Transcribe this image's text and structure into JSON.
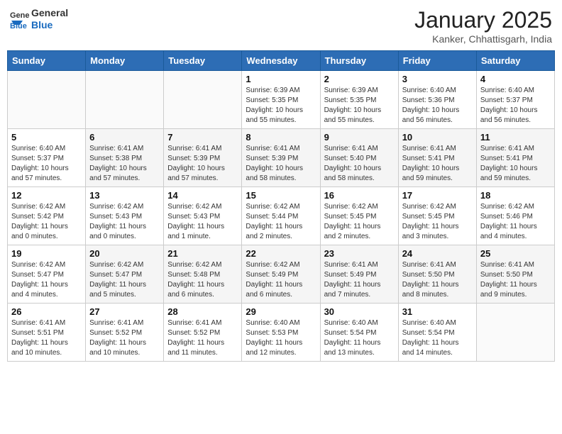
{
  "header": {
    "logo_general": "General",
    "logo_blue": "Blue",
    "month_title": "January 2025",
    "location": "Kanker, Chhattisgarh, India"
  },
  "days_of_week": [
    "Sunday",
    "Monday",
    "Tuesday",
    "Wednesday",
    "Thursday",
    "Friday",
    "Saturday"
  ],
  "weeks": [
    [
      {
        "day": "",
        "info": ""
      },
      {
        "day": "",
        "info": ""
      },
      {
        "day": "",
        "info": ""
      },
      {
        "day": "1",
        "info": "Sunrise: 6:39 AM\nSunset: 5:35 PM\nDaylight: 10 hours\nand 55 minutes."
      },
      {
        "day": "2",
        "info": "Sunrise: 6:39 AM\nSunset: 5:35 PM\nDaylight: 10 hours\nand 55 minutes."
      },
      {
        "day": "3",
        "info": "Sunrise: 6:40 AM\nSunset: 5:36 PM\nDaylight: 10 hours\nand 56 minutes."
      },
      {
        "day": "4",
        "info": "Sunrise: 6:40 AM\nSunset: 5:37 PM\nDaylight: 10 hours\nand 56 minutes."
      }
    ],
    [
      {
        "day": "5",
        "info": "Sunrise: 6:40 AM\nSunset: 5:37 PM\nDaylight: 10 hours\nand 57 minutes."
      },
      {
        "day": "6",
        "info": "Sunrise: 6:41 AM\nSunset: 5:38 PM\nDaylight: 10 hours\nand 57 minutes."
      },
      {
        "day": "7",
        "info": "Sunrise: 6:41 AM\nSunset: 5:39 PM\nDaylight: 10 hours\nand 57 minutes."
      },
      {
        "day": "8",
        "info": "Sunrise: 6:41 AM\nSunset: 5:39 PM\nDaylight: 10 hours\nand 58 minutes."
      },
      {
        "day": "9",
        "info": "Sunrise: 6:41 AM\nSunset: 5:40 PM\nDaylight: 10 hours\nand 58 minutes."
      },
      {
        "day": "10",
        "info": "Sunrise: 6:41 AM\nSunset: 5:41 PM\nDaylight: 10 hours\nand 59 minutes."
      },
      {
        "day": "11",
        "info": "Sunrise: 6:41 AM\nSunset: 5:41 PM\nDaylight: 10 hours\nand 59 minutes."
      }
    ],
    [
      {
        "day": "12",
        "info": "Sunrise: 6:42 AM\nSunset: 5:42 PM\nDaylight: 11 hours\nand 0 minutes."
      },
      {
        "day": "13",
        "info": "Sunrise: 6:42 AM\nSunset: 5:43 PM\nDaylight: 11 hours\nand 0 minutes."
      },
      {
        "day": "14",
        "info": "Sunrise: 6:42 AM\nSunset: 5:43 PM\nDaylight: 11 hours\nand 1 minute."
      },
      {
        "day": "15",
        "info": "Sunrise: 6:42 AM\nSunset: 5:44 PM\nDaylight: 11 hours\nand 2 minutes."
      },
      {
        "day": "16",
        "info": "Sunrise: 6:42 AM\nSunset: 5:45 PM\nDaylight: 11 hours\nand 2 minutes."
      },
      {
        "day": "17",
        "info": "Sunrise: 6:42 AM\nSunset: 5:45 PM\nDaylight: 11 hours\nand 3 minutes."
      },
      {
        "day": "18",
        "info": "Sunrise: 6:42 AM\nSunset: 5:46 PM\nDaylight: 11 hours\nand 4 minutes."
      }
    ],
    [
      {
        "day": "19",
        "info": "Sunrise: 6:42 AM\nSunset: 5:47 PM\nDaylight: 11 hours\nand 4 minutes."
      },
      {
        "day": "20",
        "info": "Sunrise: 6:42 AM\nSunset: 5:47 PM\nDaylight: 11 hours\nand 5 minutes."
      },
      {
        "day": "21",
        "info": "Sunrise: 6:42 AM\nSunset: 5:48 PM\nDaylight: 11 hours\nand 6 minutes."
      },
      {
        "day": "22",
        "info": "Sunrise: 6:42 AM\nSunset: 5:49 PM\nDaylight: 11 hours\nand 6 minutes."
      },
      {
        "day": "23",
        "info": "Sunrise: 6:41 AM\nSunset: 5:49 PM\nDaylight: 11 hours\nand 7 minutes."
      },
      {
        "day": "24",
        "info": "Sunrise: 6:41 AM\nSunset: 5:50 PM\nDaylight: 11 hours\nand 8 minutes."
      },
      {
        "day": "25",
        "info": "Sunrise: 6:41 AM\nSunset: 5:50 PM\nDaylight: 11 hours\nand 9 minutes."
      }
    ],
    [
      {
        "day": "26",
        "info": "Sunrise: 6:41 AM\nSunset: 5:51 PM\nDaylight: 11 hours\nand 10 minutes."
      },
      {
        "day": "27",
        "info": "Sunrise: 6:41 AM\nSunset: 5:52 PM\nDaylight: 11 hours\nand 10 minutes."
      },
      {
        "day": "28",
        "info": "Sunrise: 6:41 AM\nSunset: 5:52 PM\nDaylight: 11 hours\nand 11 minutes."
      },
      {
        "day": "29",
        "info": "Sunrise: 6:40 AM\nSunset: 5:53 PM\nDaylight: 11 hours\nand 12 minutes."
      },
      {
        "day": "30",
        "info": "Sunrise: 6:40 AM\nSunset: 5:54 PM\nDaylight: 11 hours\nand 13 minutes."
      },
      {
        "day": "31",
        "info": "Sunrise: 6:40 AM\nSunset: 5:54 PM\nDaylight: 11 hours\nand 14 minutes."
      },
      {
        "day": "",
        "info": ""
      }
    ]
  ]
}
